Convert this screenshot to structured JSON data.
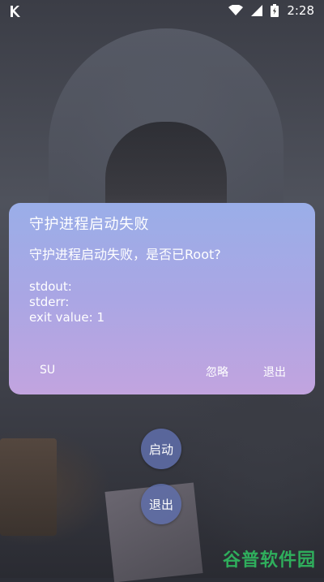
{
  "status_bar": {
    "time": "2:28",
    "icons": [
      "app-logo-icon",
      "wifi-icon",
      "signal-icon",
      "battery-icon"
    ]
  },
  "dialog": {
    "title": "守护进程启动失败",
    "message": "守护进程启动失败，是否已Root?",
    "stdout": "stdout:",
    "stderr": "stderr:",
    "exit_value": "exit value: 1",
    "buttons": {
      "su": "SU",
      "ignore": "忽略",
      "exit": "退出"
    }
  },
  "floating_buttons": {
    "start": "启动",
    "exit": "退出"
  },
  "watermark": "谷普软件园",
  "colors": {
    "dialog_top": "#9aaee8",
    "dialog_bottom": "#c2a4df",
    "round_button": "#5f6eaa",
    "watermark": "#2fae5c"
  }
}
